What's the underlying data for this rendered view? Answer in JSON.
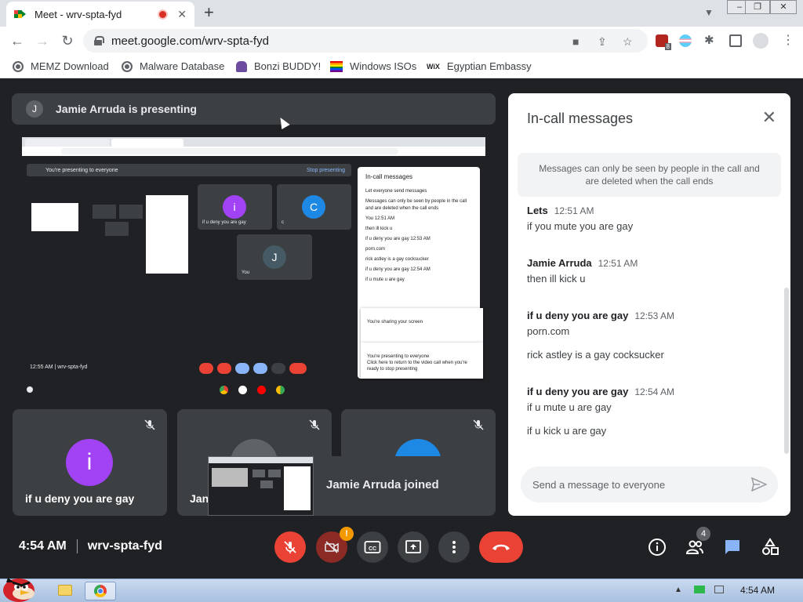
{
  "browser": {
    "tab_title": "Meet - wrv-spta-fyd",
    "tab_close": "✕",
    "new_tab": "+",
    "url": "meet.google.com/wrv-spta-fyd",
    "extension_badge": "8"
  },
  "bookmarks": [
    {
      "label": "MEMZ Download",
      "icon": "globe-icon"
    },
    {
      "label": "Malware Database",
      "icon": "globe-icon"
    },
    {
      "label": "Bonzi BUDDY!",
      "icon": "bonzi-icon"
    },
    {
      "label": "Windows ISOs",
      "icon": "rainbow-flag-icon"
    },
    {
      "label": "Egyptian Embassy",
      "icon": "wix-icon"
    }
  ],
  "wix_label": "WiX",
  "presenting": {
    "avatar_letter": "J",
    "text": "Jamie Arruda is presenting"
  },
  "shared_screen": {
    "banner": "You're presenting to everyone",
    "stop": "Stop presenting",
    "panel_title": "In-call messages",
    "tiles": [
      {
        "letter": "i",
        "name": "if u deny you are gay",
        "color": "#a142f4"
      },
      {
        "letter": "C",
        "name": "c",
        "color": "#1e88e5"
      },
      {
        "letter": "J",
        "name": "You",
        "color": "#455a64"
      }
    ],
    "time": "12:55 AM  |  wrv-spta-fyd",
    "panel_lines": [
      "Let everyone send messages",
      "Messages can only be seen by people in the call and are deleted when the call ends",
      "You  12:51 AM",
      "then ill kick u",
      "if u deny you are gay  12:53 AM",
      "porn.com",
      "rick astley is a gay cocksucker",
      "if u deny you are gay  12:54 AM",
      "if u mute u are gay"
    ],
    "notif_1": "You're sharing your screen",
    "notif_2": "You're presenting to everyone",
    "notif_3": "Click here to return to the video call when you're ready to stop presenting"
  },
  "tiles": [
    {
      "name": "if u deny you are gay",
      "letter": "i",
      "color": "#a142f4"
    },
    {
      "name": "Jan",
      "letter": "",
      "color": "#5f6368"
    },
    {
      "name": "",
      "letter": "",
      "color": "#1e88e5"
    }
  ],
  "toast": {
    "text": "Jamie Arruda joined"
  },
  "chat": {
    "title": "In-call messages",
    "info": "Messages can only be seen by people in the call and are deleted when the call ends",
    "groups": [
      {
        "sender": "Lets",
        "time": "12:51 AM",
        "messages": [
          "if you mute you are gay"
        ]
      },
      {
        "sender": "Jamie Arruda",
        "time": "12:51 AM",
        "messages": [
          "then ill kick u"
        ]
      },
      {
        "sender": "if u deny you are gay",
        "time": "12:53 AM",
        "messages": [
          "porn.com",
          "rick astley is a gay cocksucker"
        ]
      },
      {
        "sender": "if u deny you are gay",
        "time": "12:54 AM",
        "messages": [
          "if u mute u are gay",
          "if u kick u are gay"
        ]
      }
    ],
    "input_placeholder": "Send a message to everyone"
  },
  "meeting": {
    "time": "4:54 AM",
    "code": "wrv-spta-fyd",
    "people_count": "4",
    "warning": "!"
  },
  "taskbar": {
    "clock": "4:54 AM"
  },
  "colors": {
    "meet_bg": "#202124",
    "danger": "#ea4335",
    "accent": "#1a73e8"
  }
}
